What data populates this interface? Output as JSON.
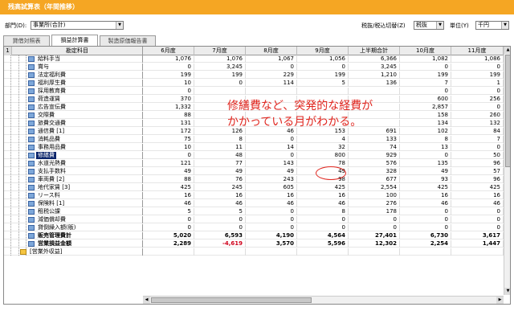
{
  "window": {
    "title": "残高試算表（年間推移）"
  },
  "toolbar": {
    "dept_label": "部門(D):",
    "dept_value": "事業所(合計)",
    "tax_label": "税抜/税込切替(Z)",
    "tax_value": "税抜",
    "unit_label": "単位(Y)",
    "unit_value": "千円"
  },
  "tabs": [
    "貸借対照表",
    "損益計算書",
    "製造原価報告書"
  ],
  "active_tab": 1,
  "grid": {
    "corner_num": "1",
    "columns": [
      "勘定科目",
      "6月度",
      "7月度",
      "8月度",
      "9月度",
      "上半期合計",
      "10月度",
      "11月度"
    ],
    "rows": [
      {
        "name": "給料手当",
        "values": [
          "1,076",
          "1,076",
          "1,067",
          "1,056",
          "6,366",
          "1,082",
          "1,086"
        ]
      },
      {
        "name": "賞与",
        "values": [
          "0",
          "3,245",
          "0",
          "0",
          "3,245",
          "0",
          "0"
        ]
      },
      {
        "name": "法定福利費",
        "values": [
          "199",
          "199",
          "229",
          "199",
          "1,210",
          "199",
          "199"
        ]
      },
      {
        "name": "福利厚生費",
        "values": [
          "10",
          "0",
          "114",
          "5",
          "136",
          "7",
          "1"
        ]
      },
      {
        "name": "採用教育費",
        "values": [
          "0",
          "",
          "",
          "",
          "",
          "0",
          "0"
        ]
      },
      {
        "name": "荷造運賃",
        "values": [
          "370",
          "",
          "",
          "",
          "",
          "600",
          "256"
        ]
      },
      {
        "name": "広告宣伝費",
        "values": [
          "1,332",
          "",
          "",
          "",
          "",
          "2,857",
          "0"
        ]
      },
      {
        "name": "交際費",
        "values": [
          "88",
          "",
          "",
          "",
          "",
          "158",
          "260"
        ]
      },
      {
        "name": "旅費交通費",
        "values": [
          "131",
          "",
          "",
          "",
          "",
          "134",
          "132"
        ]
      },
      {
        "name": "通信費 [1]",
        "values": [
          "172",
          "126",
          "46",
          "153",
          "691",
          "102",
          "84"
        ]
      },
      {
        "name": "消耗品費",
        "values": [
          "75",
          "8",
          "0",
          "4",
          "133",
          "8",
          "7"
        ]
      },
      {
        "name": "事務用品費",
        "values": [
          "10",
          "11",
          "14",
          "32",
          "74",
          "13",
          "0"
        ]
      },
      {
        "name": "修繕費",
        "values": [
          "0",
          "48",
          "0",
          "800",
          "929",
          "0",
          "50"
        ],
        "selected": true
      },
      {
        "name": "水道光熱費",
        "values": [
          "121",
          "77",
          "143",
          "78",
          "576",
          "135",
          "96"
        ]
      },
      {
        "name": "支払手数料",
        "values": [
          "49",
          "49",
          "49",
          "49",
          "328",
          "49",
          "57"
        ]
      },
      {
        "name": "車両費 [2]",
        "values": [
          "88",
          "76",
          "243",
          "98",
          "677",
          "93",
          "96"
        ]
      },
      {
        "name": "地代家賃 [3]",
        "values": [
          "425",
          "245",
          "605",
          "425",
          "2,554",
          "425",
          "425"
        ]
      },
      {
        "name": "リース料",
        "values": [
          "16",
          "16",
          "16",
          "16",
          "100",
          "16",
          "16"
        ]
      },
      {
        "name": "保険料 [1]",
        "values": [
          "46",
          "46",
          "46",
          "46",
          "276",
          "46",
          "46"
        ]
      },
      {
        "name": "租税公課",
        "values": [
          "5",
          "5",
          "0",
          "8",
          "178",
          "0",
          "0"
        ]
      },
      {
        "name": "減価償却費",
        "values": [
          "0",
          "0",
          "0",
          "0",
          "0",
          "0",
          "0"
        ]
      },
      {
        "name": "貸倒繰入額(販)",
        "values": [
          "0",
          "0",
          "0",
          "0",
          "0",
          "0",
          "0"
        ]
      },
      {
        "name": "販売管理費計",
        "values": [
          "5,020",
          "6,593",
          "4,190",
          "4,564",
          "27,401",
          "6,730",
          "3,617"
        ],
        "bold": true
      },
      {
        "name": "営業損益金額",
        "values": [
          "2,289",
          "-4,619",
          "3,570",
          "5,596",
          "12,302",
          "2,254",
          "1,447"
        ],
        "bold": true
      },
      {
        "name": "[営業外収益]",
        "values": [
          "",
          "",
          "",
          "",
          "",
          "",
          ""
        ],
        "group": true
      }
    ]
  },
  "annotation": {
    "line1": "修繕費など、突発的な経費が",
    "line2": "かかっている月がわかる。"
  },
  "colors": {
    "title_bar": "#f5a623",
    "annotation": "#e0261f",
    "negative": "#d0021b",
    "selected": "#0a246a"
  }
}
